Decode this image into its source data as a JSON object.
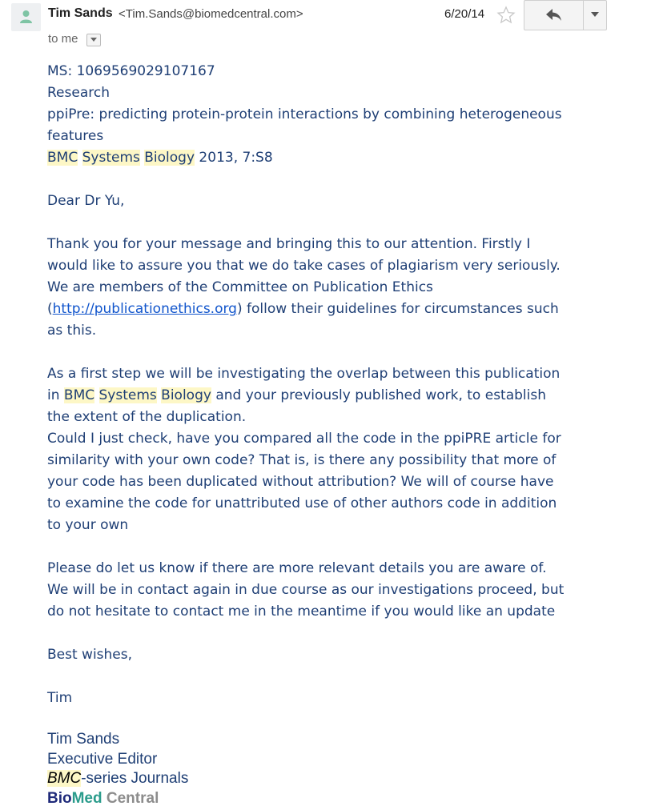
{
  "header": {
    "sender_name": "Tim Sands",
    "sender_email": "<Tim.Sands@biomedcentral.com>",
    "to_label": "to me",
    "date": "6/20/14"
  },
  "icons": {
    "avatar": "person-icon",
    "to_details": "chevron-down-icon",
    "star": "star-icon",
    "reply": "reply-icon",
    "more": "dropdown-arrow-icon"
  },
  "body": {
    "ms": "MS: 1069569029107167",
    "type": "Research",
    "title_line1": "ppiPre: predicting protein-protein interactions by combining heterogeneous",
    "title_line2": "features",
    "journal_bmc": "BMC",
    "journal_systems": "Systems",
    "journal_biology": "Biology",
    "journal_rest": " 2013, 7:S8",
    "greeting": "Dear Dr Yu,",
    "p1_l1": "Thank you for your message and bringing this to our attention. Firstly I",
    "p1_l2": "would like to assure you that we do take cases of plagiarism very seriously.",
    "p1_l3": "We are members of the Committee on Publication Ethics",
    "p1_l4_open": "(",
    "p1_l4_link": "http://publicationethics.org",
    "p1_l4_rest": ") follow their guidelines for circumstances such",
    "p1_l5": "as this.",
    "p2_l1": "As a first step we will be investigating the overlap between this publication",
    "p2_l2_pre": "in ",
    "p2_l2_post": " and your previously published work, to establish",
    "p2_l3": "the extent of the duplication.",
    "p2_l4": "Could I just check, have you compared all the code in the ppiPRE article for",
    "p2_l5": "similarity with your own code? That is, is there any possibility that more of",
    "p2_l6": "your code has been duplicated without attribution? We will of course have",
    "p2_l7": "to examine the code for unattributed use of other authors code in addition",
    "p2_l8": "to your own",
    "p3_l1": "Please do let us know if there are more relevant details you are aware of.",
    "p3_l2": "We will be in contact again in due course as our investigations proceed, but",
    "p3_l3": "do not hesitate to contact me in the meantime if you would like an update",
    "closing": "Best wishes,",
    "signoff": "Tim"
  },
  "signature": {
    "name": "Tim Sands",
    "role": "Executive Editor",
    "series_bmc": "BMC",
    "series_rest": "-series Journals",
    "logo_bio": "Bio",
    "logo_med": "Med",
    "logo_central": " Central"
  }
}
